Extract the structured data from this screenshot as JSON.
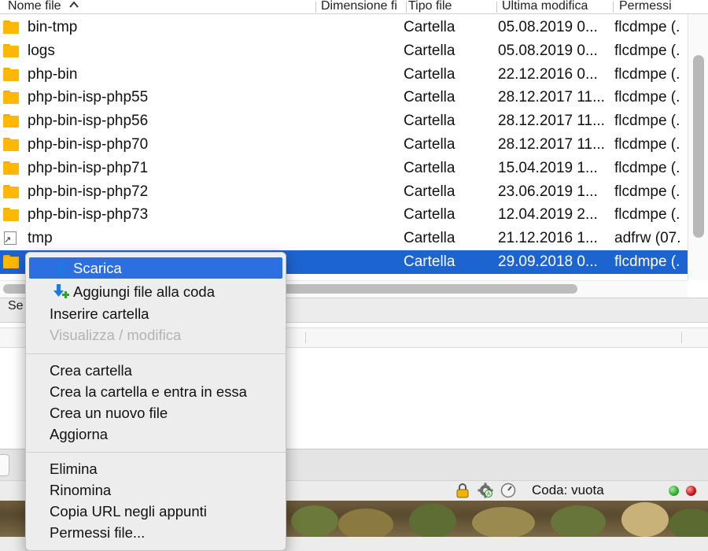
{
  "file_list": {
    "columns": {
      "name": "Nome file",
      "size": "Dimensione fi",
      "type": "Tipo file",
      "modified": "Ultima modifica",
      "permissions": "Permessi"
    },
    "sort_icon": "chevron-up-icon",
    "rows": [
      {
        "name": "bin-tmp",
        "type": "Cartella",
        "modified": "05.08.2019 0...",
        "permissions": "flcdmpe (.",
        "icon": "folder-icon"
      },
      {
        "name": "logs",
        "type": "Cartella",
        "modified": "05.08.2019 0...",
        "permissions": "flcdmpe (.",
        "icon": "folder-icon"
      },
      {
        "name": "php-bin",
        "type": "Cartella",
        "modified": "22.12.2016 0...",
        "permissions": "flcdmpe (.",
        "icon": "folder-icon"
      },
      {
        "name": "php-bin-isp-php55",
        "type": "Cartella",
        "modified": "28.12.2017 11...",
        "permissions": "flcdmpe (.",
        "icon": "folder-icon"
      },
      {
        "name": "php-bin-isp-php56",
        "type": "Cartella",
        "modified": "28.12.2017 11...",
        "permissions": "flcdmpe (.",
        "icon": "folder-icon"
      },
      {
        "name": "php-bin-isp-php70",
        "type": "Cartella",
        "modified": "28.12.2017 11...",
        "permissions": "flcdmpe (.",
        "icon": "folder-icon"
      },
      {
        "name": "php-bin-isp-php71",
        "type": "Cartella",
        "modified": "15.04.2019 1...",
        "permissions": "flcdmpe (.",
        "icon": "folder-icon"
      },
      {
        "name": "php-bin-isp-php72",
        "type": "Cartella",
        "modified": "23.06.2019 1...",
        "permissions": "flcdmpe (.",
        "icon": "folder-icon"
      },
      {
        "name": "php-bin-isp-php73",
        "type": "Cartella",
        "modified": "12.04.2019 2...",
        "permissions": "flcdmpe (.",
        "icon": "folder-icon"
      },
      {
        "name": "tmp",
        "type": "Cartella",
        "modified": "21.12.2016 1...",
        "permissions": "adfrw (07.",
        "icon": "symlink-icon"
      },
      {
        "name": "",
        "type": "Cartella",
        "modified": "29.09.2018 0...",
        "permissions": "flcdmpe (.",
        "icon": "folder-icon",
        "selected": true
      }
    ]
  },
  "selection_strip": {
    "text": "Se"
  },
  "context_menu": {
    "items": [
      {
        "label": "Scarica",
        "icon": "download-icon",
        "highlighted": true
      },
      {
        "label": "Aggiungi file alla coda",
        "icon": "add-to-queue-icon"
      },
      {
        "label": "Inserire cartella"
      },
      {
        "label": "Visualizza / modifica",
        "disabled": true
      },
      {
        "label": "Crea cartella"
      },
      {
        "label": "Crea la cartella e entra in essa"
      },
      {
        "label": "Crea un nuovo file"
      },
      {
        "label": "Aggiorna"
      },
      {
        "label": "Elimina"
      },
      {
        "label": "Rinomina"
      },
      {
        "label": "Copia URL negli appunti"
      },
      {
        "label": "Permessi file..."
      }
    ]
  },
  "status_bar": {
    "queue_status": "Coda: vuota",
    "icons": [
      "lock-icon",
      "settings-gear-icon",
      "speed-limit-icon"
    ],
    "led_colors": {
      "receive": "#2faa2f",
      "send": "#c0141b"
    }
  },
  "colors": {
    "selection": "#1c64d0",
    "menu_highlight": "#2b6fe0",
    "folder": "#ffb800"
  }
}
